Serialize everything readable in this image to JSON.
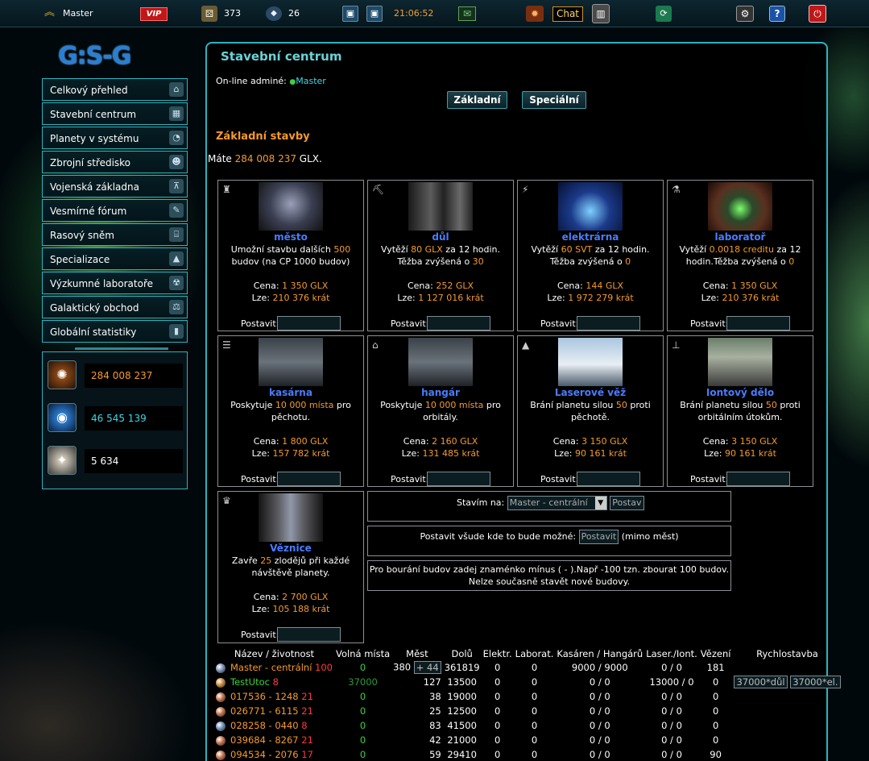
{
  "topbar": {
    "user": "Master",
    "vip": "VIP",
    "ap": "373",
    "medals": "26",
    "time": "21:06:52",
    "chat": "Chat"
  },
  "logo": "G:S-G",
  "menu": [
    {
      "label": "Celkový přehled",
      "icon": "home-icon"
    },
    {
      "label": "Stavební centrum",
      "icon": "building-icon"
    },
    {
      "label": "Planety v systému",
      "icon": "planet-icon"
    },
    {
      "label": "Zbrojní středisko",
      "icon": "soldier-icon"
    },
    {
      "label": "Vojenská základna",
      "icon": "radar-icon"
    },
    {
      "label": "Vesmírné fórum",
      "icon": "forum-icon"
    },
    {
      "label": "Rasový sněm",
      "icon": "parliament-icon"
    },
    {
      "label": "Specializace",
      "icon": "specialization-icon"
    },
    {
      "label": "Výzkumné laboratoře",
      "icon": "radiation-icon"
    },
    {
      "label": "Galaktický obchod",
      "icon": "trade-icon"
    },
    {
      "label": "Globální statistiky",
      "icon": "stats-icon"
    }
  ],
  "resources": [
    {
      "value": "284 008 237",
      "color": "#f59a2a",
      "icon": "glx-icon"
    },
    {
      "value": "46 545 139",
      "color": "#3ad8e8",
      "icon": "energy-icon"
    },
    {
      "value": "5 634",
      "color": "#ffffff",
      "icon": "credits-icon"
    }
  ],
  "main": {
    "title": "Stavební centrum",
    "online_label": "On-line adminé:",
    "online_admin": "Master",
    "tab_basic": "Základní",
    "tab_special": "Speciální",
    "section_title": "Základní stavby",
    "have_prefix": "Máte",
    "have_value": "284 008 237",
    "have_suffix": "GLX."
  },
  "buildings": [
    {
      "name": "město",
      "d1": "Umožní stavbu dalších ",
      "h1": "500",
      "d2": " budov (na CP 1000 budov)",
      "h2": "",
      "d3": "",
      "price": "1 350 GLX",
      "count": "210 376 krát"
    },
    {
      "name": "důl",
      "d1": "Vytěží ",
      "h1": "80 GLX",
      "d2": " za 12 hodin. Těžba zvýšená o ",
      "h2": "30",
      "d3": "",
      "price": "252 GLX",
      "count": "1 127 016 krát"
    },
    {
      "name": "elektrárna",
      "d1": "Vytěží ",
      "h1": "60 SVT",
      "d2": " za 12 hodin. Těžba zvýšená o ",
      "h2": "0",
      "d3": "",
      "price": "144 GLX",
      "count": "1 972 279 krát"
    },
    {
      "name": "laboratoř",
      "d1": "Vytěží ",
      "h1": "0.0018 creditu",
      "d2": " za 12 hodin.Těžba zvýšená o ",
      "h2": "0",
      "d3": "",
      "price": "1 350 GLX",
      "count": "210 376 krát"
    },
    {
      "name": "kasárna",
      "d1": "Poskytuje ",
      "h1": "10 000 místa",
      "d2": " pro pěchotu.",
      "h2": "",
      "d3": "",
      "price": "1 800 GLX",
      "count": "157 782 krát"
    },
    {
      "name": "hangár",
      "d1": "Poskytuje ",
      "h1": "10 000 místa",
      "d2": " pro orbitály.",
      "h2": "",
      "d3": "",
      "price": "2 160 GLX",
      "count": "131 485 krát"
    },
    {
      "name": "Laserové věž",
      "d1": "Brání planetu silou ",
      "h1": "50",
      "d2": " proti pěchotě.",
      "h2": "",
      "d3": "",
      "price": "3 150 GLX",
      "count": "90 161 krát"
    },
    {
      "name": "Iontový dělo",
      "d1": "Brání planetu silou ",
      "h1": "50",
      "d2": " proti orbitálním útokům.",
      "h2": "",
      "d3": "",
      "price": "3 150 GLX",
      "count": "90 161 krát"
    },
    {
      "name": "Věznice",
      "d1": "Zavře ",
      "h1": "25",
      "d2": " zlodějů při každé návštěvě planety.",
      "h2": "",
      "d3": "",
      "price": "2 700 GLX",
      "count": "105 188 krát"
    }
  ],
  "labels": {
    "price": "Cena:",
    "count": "Lze:",
    "build": "Postavit:"
  },
  "buildon": {
    "label": "Stavím na:",
    "selected": "Master - centrální",
    "button": "Postav"
  },
  "buildall": {
    "text": "Postavit všude kde to bude možné:",
    "button": "Postavit",
    "suffix": "(mimo měst)"
  },
  "note": {
    "line1": "Pro bourání budov zadej znaménko mínus ( - ).Např -100 tzn. zbourat 100 budov.",
    "line2": "Nelze současně stavět nové budovy."
  },
  "table": {
    "headers": [
      "Název / životnost",
      "Volná místa",
      "Měst",
      "Dolů",
      "Elektr.",
      "Laborat.",
      "Kasáren / Hangárů",
      "Laser./Iont.",
      "Vězení",
      "Rychlostavba"
    ],
    "rows": [
      {
        "name": "Master - centrální",
        "life": "100",
        "free": "0",
        "cities": "380",
        "extra": "+ 44",
        "mines": "361819",
        "el": "0",
        "lab": "0",
        "kh": "9000 / 9000",
        "li": "0 / 0",
        "pr": "181",
        "q1": "",
        "q2": "",
        "planet": "#7a8fb3",
        "nameColor": "#f59a2a"
      },
      {
        "name": "TestUtoc",
        "life": "8",
        "free": "37000",
        "cities": "127",
        "extra": "",
        "mines": "13500",
        "el": "0",
        "lab": "0",
        "kh": "0 / 0",
        "li": "13000 / 0",
        "pr": "0",
        "q1": "37000*důl",
        "q2": "37000*el.",
        "planet": "#c98a3c",
        "nameColor": "#3cd23c"
      },
      {
        "name": "017536 - 1248",
        "life": "21",
        "free": "0",
        "cities": "38",
        "extra": "",
        "mines": "19000",
        "el": "0",
        "lab": "0",
        "kh": "0 / 0",
        "li": "0 / 0",
        "pr": "0",
        "q1": "",
        "q2": "",
        "planet": "#c2704a",
        "nameColor": "#f59a2a"
      },
      {
        "name": "026771 - 6115",
        "life": "21",
        "free": "0",
        "cities": "25",
        "extra": "",
        "mines": "12500",
        "el": "0",
        "lab": "0",
        "kh": "0 / 0",
        "li": "0 / 0",
        "pr": "0",
        "q1": "",
        "q2": "",
        "planet": "#c2704a",
        "nameColor": "#f59a2a"
      },
      {
        "name": "028258 - 0440",
        "life": "8",
        "free": "0",
        "cities": "83",
        "extra": "",
        "mines": "41500",
        "el": "0",
        "lab": "0",
        "kh": "0 / 0",
        "li": "0 / 0",
        "pr": "0",
        "q1": "",
        "q2": "",
        "planet": "#6f8fb8",
        "nameColor": "#f59a2a"
      },
      {
        "name": "039684 - 8267",
        "life": "21",
        "free": "0",
        "cities": "42",
        "extra": "",
        "mines": "21000",
        "el": "0",
        "lab": "0",
        "kh": "0 / 0",
        "li": "0 / 0",
        "pr": "0",
        "q1": "",
        "q2": "",
        "planet": "#c2704a",
        "nameColor": "#f59a2a"
      },
      {
        "name": "094534 - 2076",
        "life": "17",
        "free": "0",
        "cities": "59",
        "extra": "",
        "mines": "29410",
        "el": "0",
        "lab": "0",
        "kh": "0 / 0",
        "li": "0 / 0",
        "pr": "90",
        "q1": "",
        "q2": "",
        "planet": "#c2704a",
        "nameColor": "#f59a2a"
      }
    ]
  }
}
